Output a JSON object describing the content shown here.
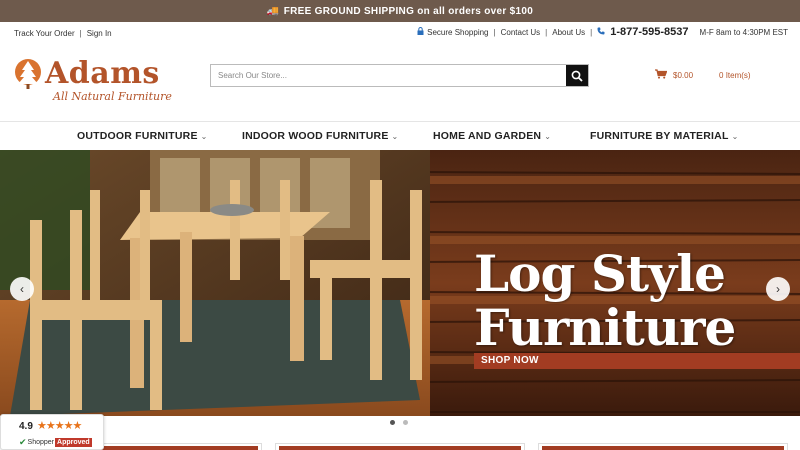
{
  "promo": {
    "text": "FREE GROUND SHIPPING on all orders over $100"
  },
  "utility": {
    "track_order": "Track Your Order",
    "sign_in": "Sign In",
    "secure_shopping": "Secure Shopping",
    "contact_us": "Contact Us",
    "about_us": "About Us",
    "phone": "1-877-595-8537",
    "hours": "M-F 8am to 4:30PM EST"
  },
  "logo": {
    "name": "Adams",
    "tagline": "All Natural Furniture"
  },
  "search": {
    "placeholder": "Search Our Store..."
  },
  "cart": {
    "total": "$0.00",
    "items": "0 Item(s)"
  },
  "nav": {
    "items": [
      {
        "label": "OUTDOOR FURNITURE"
      },
      {
        "label": "INDOOR WOOD FURNITURE"
      },
      {
        "label": "HOME AND GARDEN"
      },
      {
        "label": "FURNITURE BY MATERIAL"
      }
    ]
  },
  "hero": {
    "title_line1": "Log Style",
    "title_line2": "Furniture",
    "cta": "SHOP NOW",
    "slide_count": 2,
    "active_slide": 1
  },
  "badge": {
    "score": "4.9",
    "stars": "★★★★★",
    "brand_prefix": "Shopper",
    "brand_suffix": "Approved"
  },
  "colors": {
    "promo_bg": "#6e5a4c",
    "brand": "#b3542a",
    "cta": "#a23c22",
    "link_icon": "#2a6ebb"
  }
}
